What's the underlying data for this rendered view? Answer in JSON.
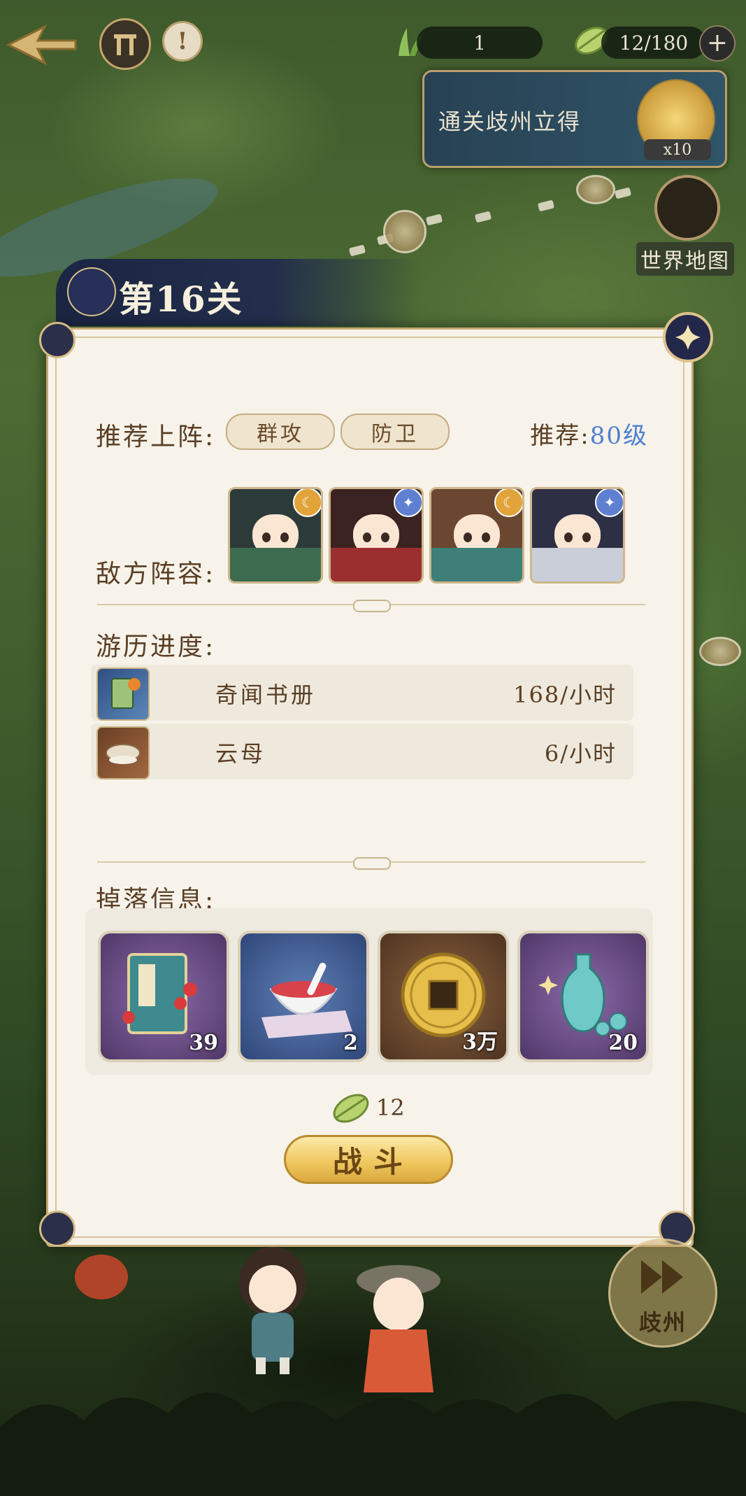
{
  "topbar": {
    "counter_value": "1",
    "stamina": "12/180",
    "plus_symbol": "+"
  },
  "quest": {
    "text": "通关歧州立得",
    "reward_count": "x10"
  },
  "world_map": {
    "label": "世界地图"
  },
  "level": {
    "title": "第16关"
  },
  "dialog": {
    "recommend_label": "推荐上阵:",
    "recommend_tags": [
      "群攻",
      "防卫"
    ],
    "recommend_level_prefix": "推荐:",
    "recommend_level_value": "80级",
    "enemy_label": "敌方阵容:",
    "enemies": [
      {
        "badge": "moon-icon",
        "hair": "#2c3b3a",
        "robe": "#3d6b4f"
      },
      {
        "badge": "star-icon",
        "hair": "#3a2320",
        "robe": "#9b2f2f"
      },
      {
        "badge": "moon-icon",
        "hair": "#6b4630",
        "robe": "#3e7f7a"
      },
      {
        "badge": "star-icon",
        "hair": "#2d2f45",
        "robe": "#c9ced8"
      }
    ],
    "progress_label": "游历进度:",
    "progress_items": [
      {
        "name": "奇闻书册",
        "rate": "168/小时"
      },
      {
        "name": "云母",
        "rate": "6/小时"
      }
    ],
    "drop_label": "掉落信息:",
    "drops": [
      {
        "qty": "39",
        "icon": "book-icon",
        "bg": "#6a4e8a"
      },
      {
        "qty": "2",
        "icon": "bowl-icon",
        "bg": "#3f5a8d"
      },
      {
        "qty": "3万",
        "icon": "coin-icon",
        "bg": "#6b4a2f"
      },
      {
        "qty": "20",
        "icon": "vase-icon",
        "bg": "#6a4e8a"
      }
    ],
    "cost": "12",
    "fight_label": "战斗"
  },
  "next": {
    "label": "歧州"
  }
}
